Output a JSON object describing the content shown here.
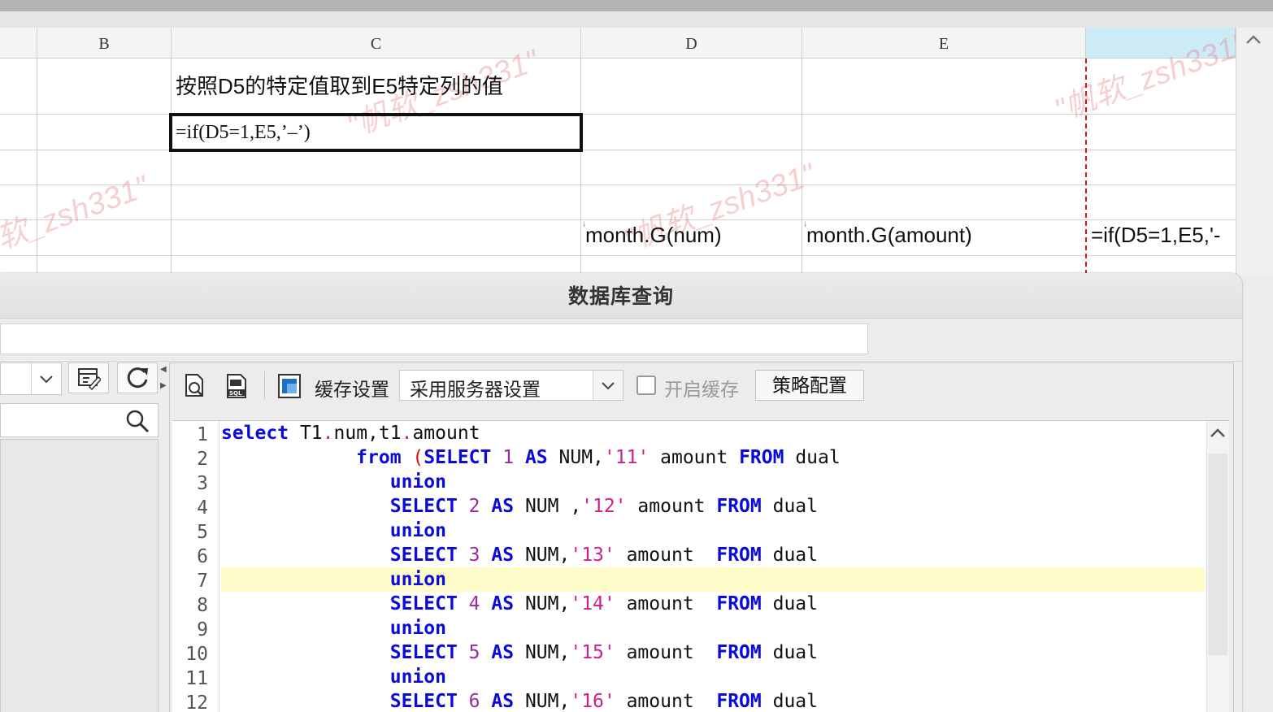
{
  "sheet": {
    "columns": [
      "B",
      "C",
      "D",
      "E",
      ""
    ],
    "cells": {
      "c1": "按照D5的特定值取到E5特定列的值",
      "c2": "=if(D5=1,E5,’–’)",
      "d5": "month.G(num)",
      "e5": "month.G(amount)",
      "f5": "=if(D5=1,E5,'-"
    },
    "watermark": "\"帆软_zsh331\""
  },
  "dialog": {
    "title": "数据库查询",
    "toolbar": {
      "cache_settings_label": "缓存设置",
      "cache_mode_value": "采用服务器设置",
      "enable_cache_label": "开启缓存",
      "strategy_button": "策略配置"
    },
    "editor": {
      "line_numbers": [
        "1",
        "2",
        "3",
        "4",
        "5",
        "6",
        "7",
        "8",
        "9",
        "10",
        "11",
        "12"
      ],
      "highlighted_line": 7,
      "lines": [
        "select T1.num,t1.amount",
        "            from (SELECT 1 AS NUM,'11' amount FROM dual",
        "               union",
        "               SELECT 2 AS NUM ,'12' amount FROM dual",
        "               union",
        "               SELECT 3 AS NUM,'13' amount  FROM dual",
        "               union",
        "               SELECT 4 AS NUM,'14' amount  FROM dual",
        "               union",
        "               SELECT 5 AS NUM,'15' amount  FROM dual",
        "               union",
        "               SELECT 6 AS NUM,'16' amount  FROM dual"
      ]
    }
  },
  "colors": {
    "keyword": "#0b0bd9",
    "number": "#9c2a9c",
    "string": "#d01f8a",
    "highlight_line": "#fdfcc8",
    "active_column_header": "#cdebf7",
    "red_boundary": "#e0141b"
  }
}
